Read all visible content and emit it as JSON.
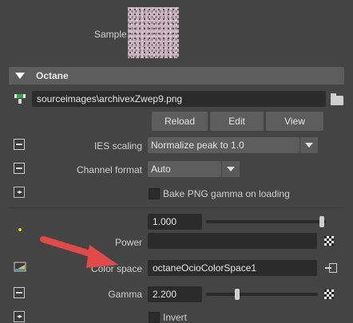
{
  "sample": {
    "label": "Sample"
  },
  "section": {
    "title": "Octane"
  },
  "file": {
    "path": "sourceimages\\archivexZwep9.png"
  },
  "buttons": {
    "reload": "Reload",
    "edit": "Edit",
    "view": "View"
  },
  "ies_scaling": {
    "label": "IES scaling",
    "value": "Normalize peak to 1.0"
  },
  "channel_format": {
    "label": "Channel format",
    "value": "Auto"
  },
  "bake_png": {
    "label": "Bake PNG gamma on loading",
    "checked": false
  },
  "power": {
    "label": "Power",
    "value": "1.000",
    "slider_fraction": 1.0
  },
  "color_space": {
    "label": "Color space",
    "value": "octaneOcioColorSpace1"
  },
  "gamma": {
    "label": "Gamma",
    "value": "2.200",
    "slider_fraction": 0.3
  },
  "invert": {
    "label": "Invert",
    "checked": false
  },
  "annotation": {
    "arrow_color": "#e24a4a"
  }
}
